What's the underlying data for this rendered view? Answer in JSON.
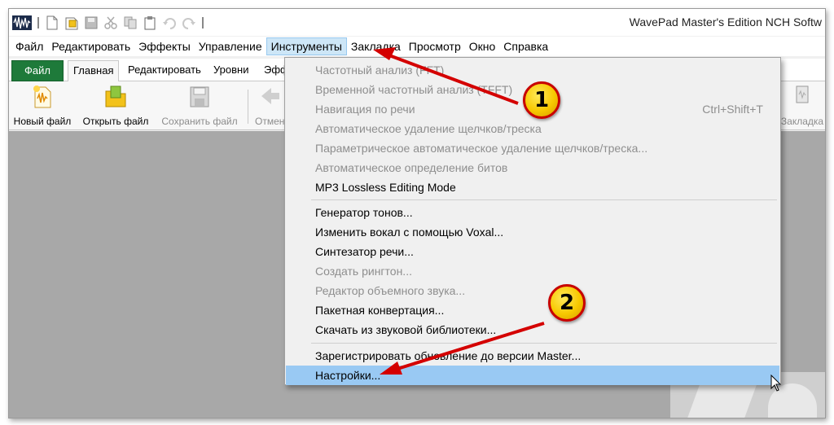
{
  "app": {
    "title": "WavePad Master's Edition NCH Softw"
  },
  "quick_access": [
    "wavepad-logo-icon",
    "new-file-icon",
    "open-file-icon",
    "save-icon",
    "cut-icon",
    "copy-icon",
    "paste-icon",
    "undo-icon",
    "redo-icon"
  ],
  "menubar": {
    "items": [
      "Файл",
      "Редактировать",
      "Эффекты",
      "Управление",
      "Инструменты",
      "Закладка",
      "Просмотр",
      "Окно",
      "Справка"
    ],
    "active": "Инструменты"
  },
  "tabs": {
    "file": "Файл",
    "home": "Главная",
    "edit": "Редактировать",
    "levels": "Уровни",
    "effects_partial": "Эфф"
  },
  "ribbon": {
    "new_file": "Новый файл",
    "open_file": "Открыть файл",
    "save_file": "Сохранить файл",
    "undo_partial": "Отмен",
    "bookmark": "Закладка"
  },
  "tools_menu": {
    "items": [
      {
        "label": "Частотный анализ (FFT)",
        "enabled": false
      },
      {
        "label": "Временной частотный анализ (TFFT)",
        "enabled": false
      },
      {
        "label": "Навигация по речи",
        "enabled": false,
        "shortcut": "Ctrl+Shift+T"
      },
      {
        "label": "Автоматическое удаление щелчков/треска",
        "enabled": false
      },
      {
        "label": "Параметрическое автоматическое удаление щелчков/треска...",
        "enabled": false
      },
      {
        "label": "Автоматическое определение битов",
        "enabled": false
      },
      {
        "label": "MP3 Lossless Editing Mode",
        "enabled": true
      },
      {
        "label": "Генератор тонов...",
        "enabled": true
      },
      {
        "label": "Изменить вокал с помощью Voxal...",
        "enabled": true
      },
      {
        "label": "Синтезатор речи...",
        "enabled": true
      },
      {
        "label": "Создать рингтон...",
        "enabled": false
      },
      {
        "label": "Редактор объемного звука...",
        "enabled": false
      },
      {
        "label": "Пакетная конвертация...",
        "enabled": true
      },
      {
        "label": "Скачать из звуковой библиотеки...",
        "enabled": true
      },
      {
        "label": "Зарегистрировать обновление до версии Master...",
        "enabled": true
      },
      {
        "label": "Настройки...",
        "enabled": true,
        "highlighted": true
      }
    ]
  },
  "annotations": {
    "badge_1": "1",
    "badge_2": "2",
    "arrow_color": "#d40000",
    "badge_color": "#f7c800"
  }
}
